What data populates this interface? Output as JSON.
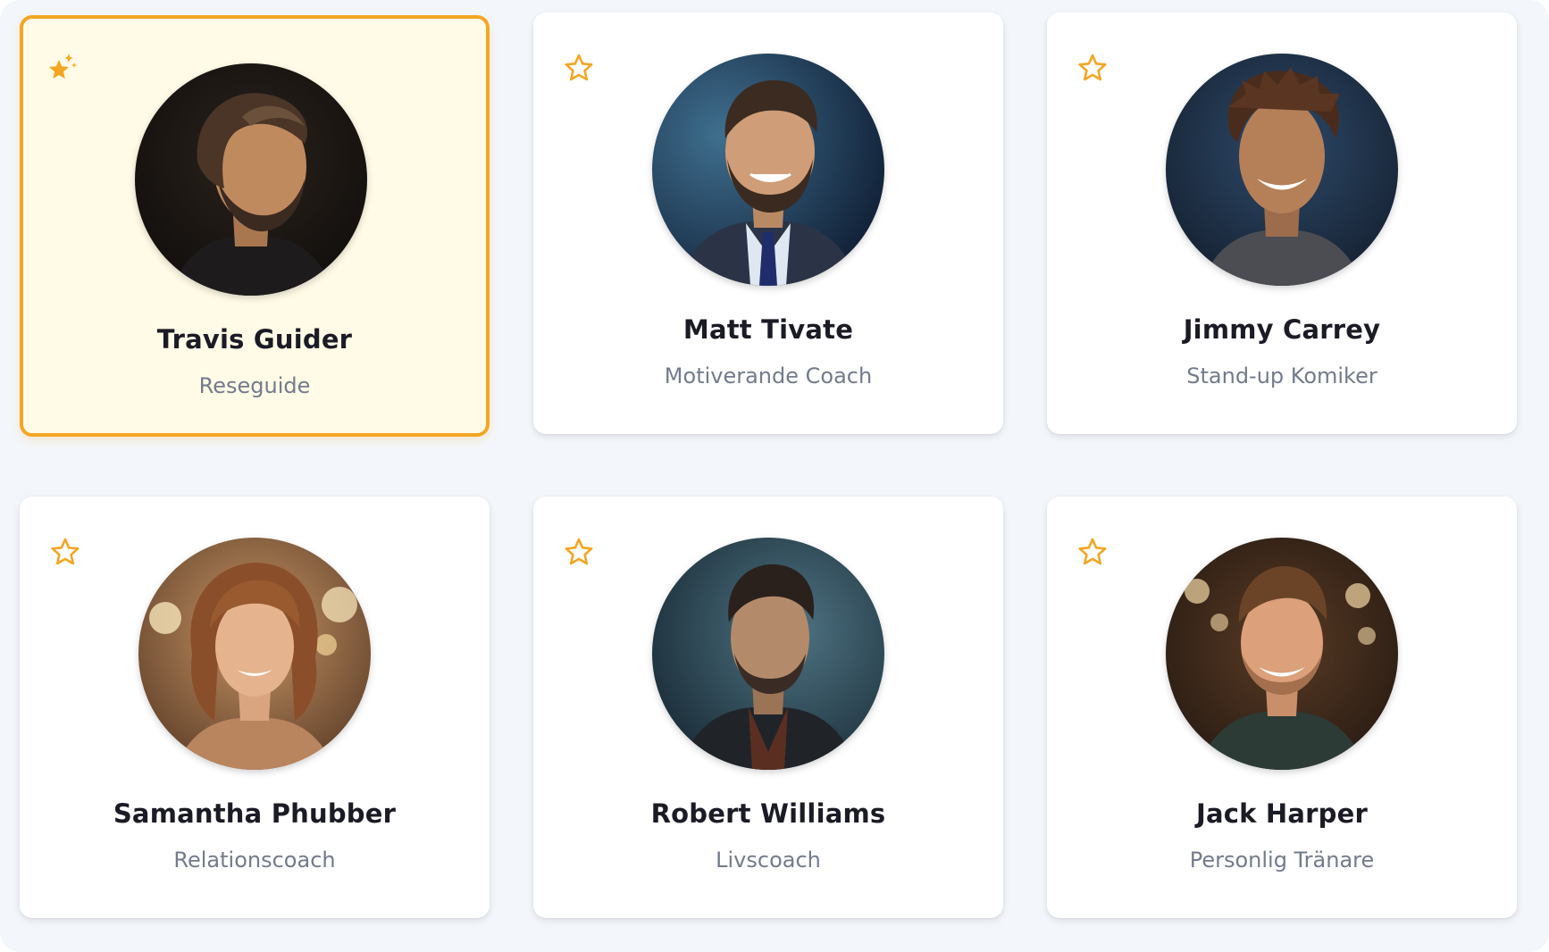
{
  "colors": {
    "accent": "#f4a623",
    "selected_background": "#fffbe6",
    "card_background": "#ffffff",
    "page_background": "#f3f6fa",
    "name_text": "#1b1b26",
    "role_text": "#737b8c"
  },
  "cards": [
    {
      "name": "Travis Guider",
      "role": "Reseguide",
      "selected": true,
      "favorite_icon": "sparkle-star-icon-filled"
    },
    {
      "name": "Matt Tivate",
      "role": "Motiverande Coach",
      "selected": false,
      "favorite_icon": "star-outline-icon"
    },
    {
      "name": "Jimmy Carrey",
      "role": "Stand-up Komiker",
      "selected": false,
      "favorite_icon": "star-outline-icon"
    },
    {
      "name": "Samantha Phubber",
      "role": "Relationscoach",
      "selected": false,
      "favorite_icon": "star-outline-icon"
    },
    {
      "name": "Robert Williams",
      "role": "Livscoach",
      "selected": false,
      "favorite_icon": "star-outline-icon"
    },
    {
      "name": "Jack Harper",
      "role": "Personlig Tränare",
      "selected": false,
      "favorite_icon": "star-outline-icon"
    }
  ]
}
